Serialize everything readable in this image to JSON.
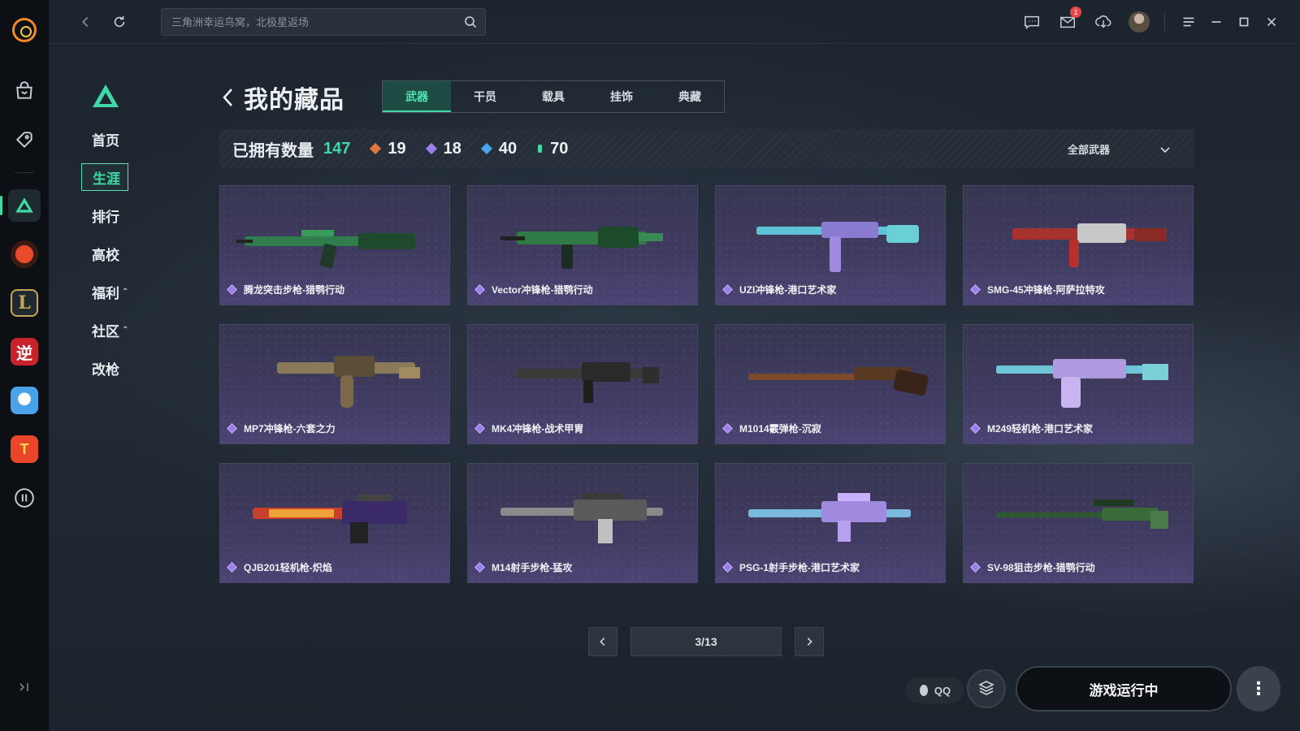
{
  "search": {
    "placeholder": "三角洲幸运鸟窝，北极星返场"
  },
  "topbar": {
    "mail_badge": "1"
  },
  "sidebar": {
    "items": [
      {
        "label": "首页"
      },
      {
        "label": "生涯"
      },
      {
        "label": "排行"
      },
      {
        "label": "高校"
      },
      {
        "label": "福利"
      },
      {
        "label": "社区"
      },
      {
        "label": "改枪"
      }
    ],
    "caret": "⌃"
  },
  "page": {
    "title": "我的藏品"
  },
  "tabs": [
    {
      "label": "武器"
    },
    {
      "label": "干员"
    },
    {
      "label": "载具"
    },
    {
      "label": "挂饰"
    },
    {
      "label": "典藏"
    }
  ],
  "stats": {
    "owned_label": "已拥有数量",
    "owned_count": "147",
    "rarities": [
      {
        "count": "19",
        "color": "#e0783a"
      },
      {
        "count": "18",
        "color": "#9c7ee8"
      },
      {
        "count": "40",
        "color": "#4aa3e8"
      },
      {
        "count": "70",
        "color": "#3fd9a6"
      }
    ],
    "filter_label": "全部武器"
  },
  "items": [
    {
      "name": "腾龙突击步枪-猎鹗行动",
      "color": "#2e7d4a"
    },
    {
      "name": "Vector冲锋枪-猎鹗行动",
      "color": "#2f7a45"
    },
    {
      "name": "UZI冲锋枪-港口艺术家",
      "color": "#5ec3d6"
    },
    {
      "name": "SMG-45冲锋枪-阿萨拉特攻",
      "color": "#a8332e"
    },
    {
      "name": "MP7冲锋枪-六套之力",
      "color": "#8a7a5a"
    },
    {
      "name": "MK4冲锋枪-战术甲胄",
      "color": "#3a3a38"
    },
    {
      "name": "M1014霰弹枪-沉寂",
      "color": "#7a4a2a"
    },
    {
      "name": "M249轻机枪-港口艺术家",
      "color": "#6cc6d8"
    },
    {
      "name": "QJB201轻机枪-炽焰",
      "color": "#c8402a"
    },
    {
      "name": "M14射手步枪-猛攻",
      "color": "#8a8a8a"
    },
    {
      "name": "PSG-1射手步枪-港口艺术家",
      "color": "#7ab8dc"
    },
    {
      "name": "SV-98狙击步枪-猎鹗行动",
      "color": "#2e5a30"
    }
  ],
  "pagination": {
    "current": "3/13"
  },
  "bottom": {
    "qq_label": "QQ",
    "run_label": "游戏运行中",
    "more_label": "⋮"
  }
}
